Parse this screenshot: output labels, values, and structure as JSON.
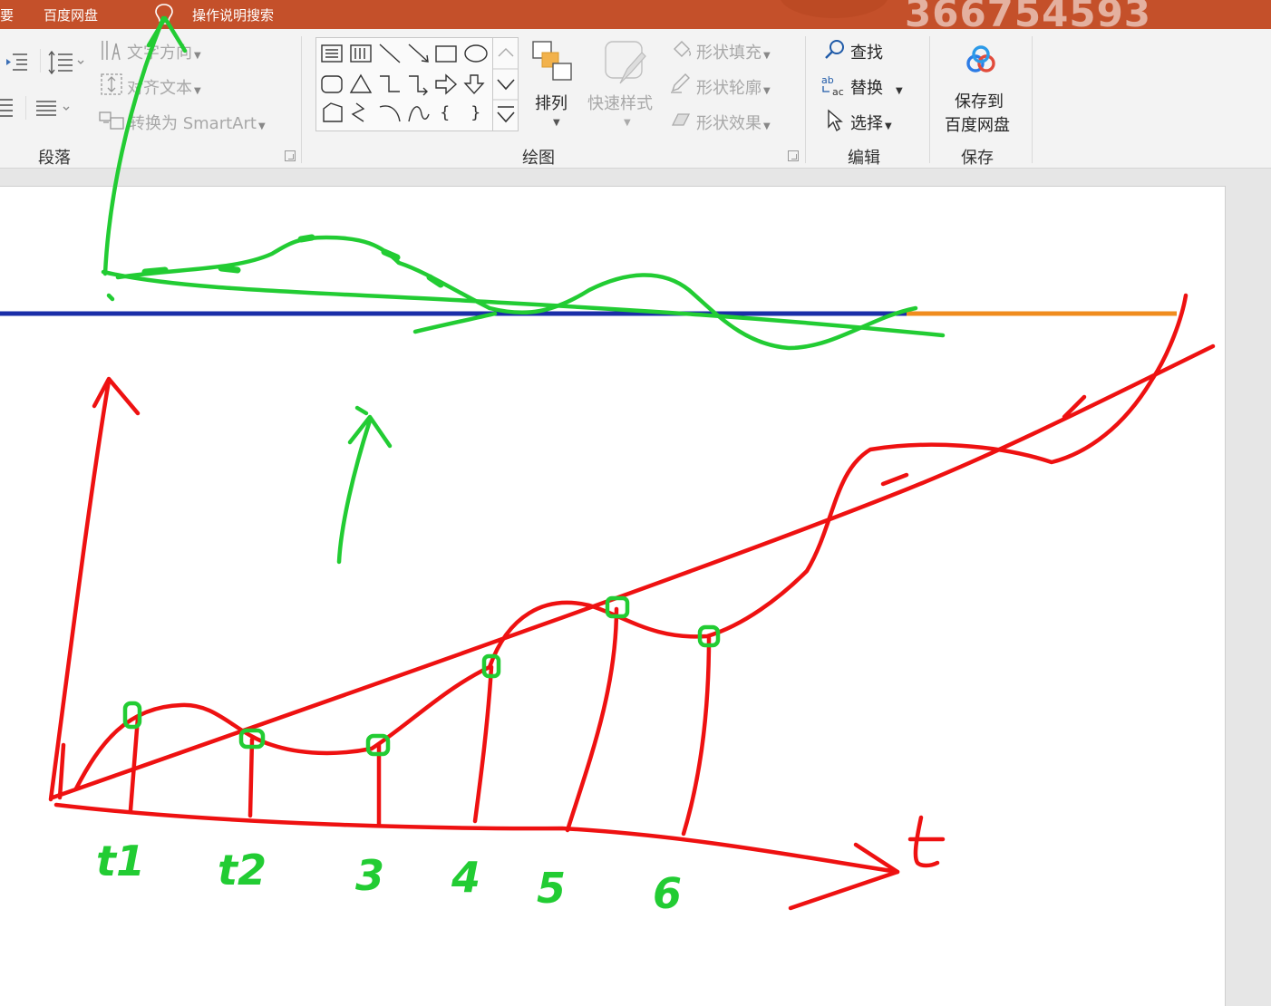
{
  "titlebar": {
    "left_item": "要",
    "baidu_tab": "百度网盘",
    "search_hint": "操作说明搜索",
    "watermark": "366754593"
  },
  "ribbon": {
    "paragraph": {
      "text_direction": "文字方向",
      "align_text": "对齐文本",
      "convert_smartart": "转换为 SmartArt",
      "group_label": "段落"
    },
    "drawing": {
      "arrange": "排列",
      "quick_styles": "快速样式",
      "shape_fill": "形状填充",
      "shape_outline": "形状轮廓",
      "shape_effects": "形状效果",
      "group_label": "绘图"
    },
    "editing": {
      "find": "查找",
      "replace": "替换",
      "select": "选择",
      "group_label": "编辑"
    },
    "save": {
      "save_to_line1": "保存到",
      "save_to_line2": "百度网盘",
      "group_label": "保存"
    }
  },
  "annotations": {
    "axis_label_t": "t",
    "tick_labels": [
      "t1",
      "t2",
      "3",
      "4",
      "5",
      "6"
    ]
  },
  "colors": {
    "title_bar": "#c4502a",
    "ink_red": "#ee1111",
    "ink_green": "#22cc33",
    "blue_line": "#1a2ea8",
    "orange_line": "#f08c1e"
  }
}
